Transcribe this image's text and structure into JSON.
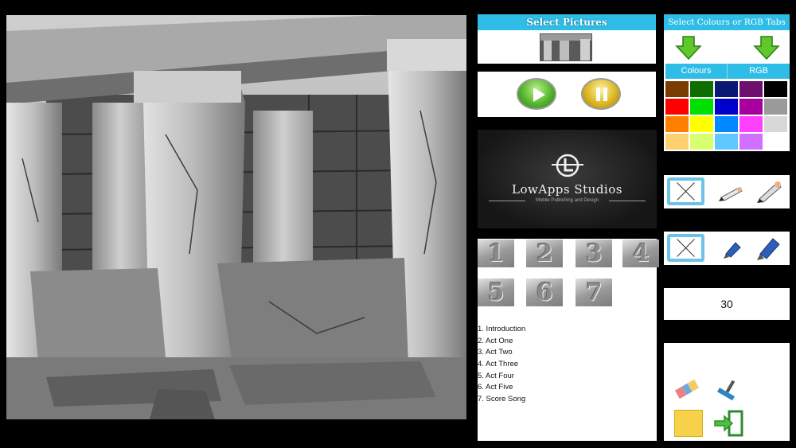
{
  "canvas": {
    "image": "temple-ruins-photo"
  },
  "select_pictures": {
    "title": "Select Pictures",
    "thumbnail": "temple-ruins-thumbnail"
  },
  "playback": {
    "play_icon": "play-icon",
    "pause_icon": "pause-icon"
  },
  "logo": {
    "name": "LowApps Studios",
    "tagline": "Mobile Publishing and Design"
  },
  "chapters": {
    "tiles": [
      "1",
      "2",
      "3",
      "4",
      "5",
      "6",
      "7"
    ],
    "list": [
      "1. Introduction",
      "2. Act One",
      "3. Act Two",
      "4. Act Three",
      "5. Act Four",
      "6. Act Five",
      "7. Score Song"
    ]
  },
  "colour_picker": {
    "title": "Select Colours or RGB Tabs",
    "tabs": [
      "Colours",
      "RGB"
    ],
    "swatches": [
      "#7a3b00",
      "#0f6e00",
      "#0a1873",
      "#6e0e6e",
      "#000000",
      "#ff0000",
      "#00e000",
      "#0000cc",
      "#a8009e",
      "#9a9a9a",
      "#ff8000",
      "#ffff00",
      "#0088ff",
      "#ff40ff",
      "#d8d8d8",
      "#ffd070",
      "#d8ff70",
      "#60c8ff",
      "#d070ff",
      "#ffffff"
    ]
  },
  "brush_size": {
    "value": "30"
  },
  "tools": {
    "eraser": "eraser-icon",
    "wiper": "squeegee-icon",
    "note": "note-icon",
    "exit": "exit-icon"
  },
  "colors": {
    "accent": "#2ebde6",
    "panel": "#ffffff",
    "background": "#000000"
  }
}
